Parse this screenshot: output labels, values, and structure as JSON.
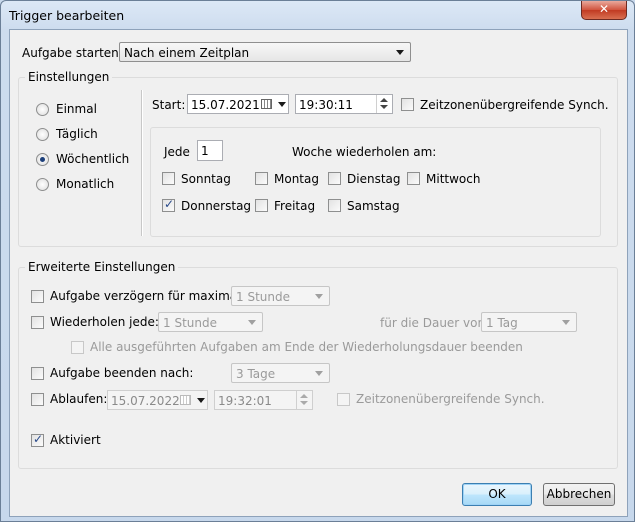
{
  "window": {
    "title": "Trigger bearbeiten",
    "close_label": "✕"
  },
  "aufgabe_starten": {
    "label": "Aufgabe starten:",
    "value": "Nach einem Zeitplan"
  },
  "einstellungen": {
    "title": "Einstellungen",
    "radios": [
      {
        "label": "Einmal",
        "checked": false
      },
      {
        "label": "Täglich",
        "checked": false
      },
      {
        "label": "Wöchentlich",
        "checked": true
      },
      {
        "label": "Monatlich",
        "checked": false
      }
    ],
    "start_label": "Start:",
    "start_date": "15.07.2021",
    "start_time": "19:30:11",
    "sync_label": "Zeitzonenübergreifende Synch.",
    "jede_label": "Jede",
    "jede_value": "1",
    "woche_label": "Woche wiederholen am:",
    "days": [
      {
        "label": "Sonntag",
        "checked": false
      },
      {
        "label": "Montag",
        "checked": false
      },
      {
        "label": "Dienstag",
        "checked": false
      },
      {
        "label": "Mittwoch",
        "checked": false
      },
      {
        "label": "Donnerstag",
        "checked": true
      },
      {
        "label": "Freitag",
        "checked": false
      },
      {
        "label": "Samstag",
        "checked": false
      }
    ]
  },
  "erweitert": {
    "title": "Erweiterte Einstellungen",
    "verzoegern_label": "Aufgabe verzögern für maximal:",
    "verzoegern_value": "1 Stunde",
    "wiederholen_label": "Wiederholen jede:",
    "wiederholen_value": "1 Stunde",
    "dauer_label": "für die Dauer von:",
    "dauer_value": "1 Tag",
    "alle_beenden_label": "Alle ausgeführten Aufgaben am Ende der Wiederholungsdauer beenden",
    "beenden_label": "Aufgabe beenden nach:",
    "beenden_value": "3 Tage",
    "ablaufen_label": "Ablaufen:",
    "ablaufen_date": "15.07.2022",
    "ablaufen_time": "19:32:01",
    "ablaufen_sync_label": "Zeitzonenübergreifende Synch.",
    "aktiviert_label": "Aktiviert",
    "aktiviert_checked": true
  },
  "buttons": {
    "ok": "OK",
    "abbrechen": "Abbrechen"
  },
  "colors": {
    "title_bg": "#cddcee",
    "client_bg": "#f0f0f0",
    "close_red": "#c13a22",
    "default_button": "#3c7fb1"
  }
}
